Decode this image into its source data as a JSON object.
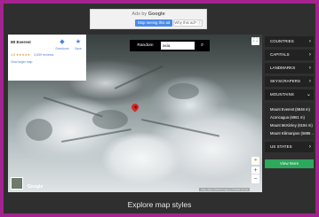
{
  "ad": {
    "title_prefix": "Ads by",
    "title_brand": "Google",
    "stop_label": "Stop seeing this ad",
    "why_label": "Why this ad? ⓘ"
  },
  "map": {
    "info_card": {
      "name": "Mt Everest",
      "rating": "4.8 ★★★★★",
      "reviews": "3,639 reviews",
      "larger_map": "View larger map",
      "directions_label": "Directions",
      "save_label": "Save"
    },
    "random_label": "Random",
    "search_value": "asia",
    "attribution": "Map data ©2024  Imagery ©2024  Terms",
    "logo": "Google"
  },
  "sidebar": {
    "categories": [
      {
        "label": "COUNTRIES"
      },
      {
        "label": "CAPITALS"
      },
      {
        "label": "LANDMARKS"
      },
      {
        "label": "SKYSCRAPERS"
      },
      {
        "label": "MOUNTAINS"
      }
    ],
    "mountains": [
      {
        "label": "Mount Everest (8848 m)"
      },
      {
        "label": "Aconcagua (6961 m)"
      },
      {
        "label": "Mount McKinley (6194 m)"
      },
      {
        "label": "Mount Kilimanjaro (5895 ..."
      }
    ],
    "us_states": {
      "label": "US STATES"
    },
    "view_more": "View More"
  },
  "caption": "Explore map styles",
  "icons": {
    "directions": "directions-icon",
    "save": "star-icon",
    "search": "search-icon",
    "fullscreen": "fullscreen-icon",
    "pegman": "pegman-icon",
    "pin": "map-pin-icon",
    "chevron_right": "chevron-right-icon",
    "chevron_down": "chevron-down-icon"
  },
  "colors": {
    "page_bg": "#a3248f",
    "frame_bg": "#2f2f2f",
    "accent_green": "#2da85d",
    "pin_red": "#d42a22",
    "link_blue": "#4a7fd6"
  }
}
